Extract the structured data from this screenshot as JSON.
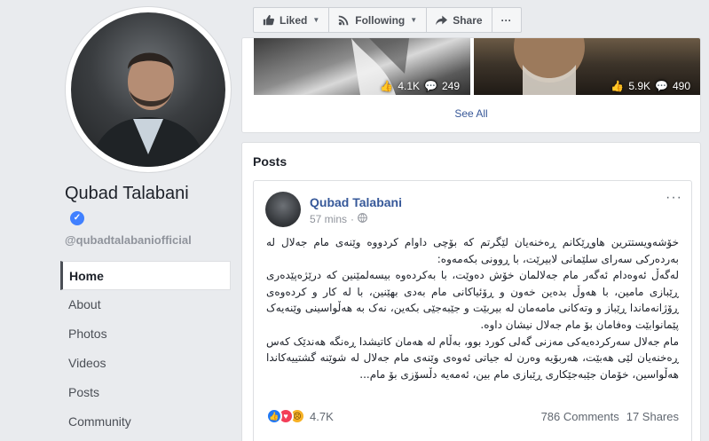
{
  "profile": {
    "name": "Qubad Talabani",
    "handle": "@qubadtalabaniofficial",
    "verified_symbol": "✓"
  },
  "nav": {
    "items": [
      {
        "label": "Home"
      },
      {
        "label": "About"
      },
      {
        "label": "Photos"
      },
      {
        "label": "Videos"
      },
      {
        "label": "Posts"
      },
      {
        "label": "Community"
      }
    ]
  },
  "actionbar": {
    "liked_label": "Liked",
    "following_label": "Following",
    "share_label": "Share",
    "more_label": "···"
  },
  "photos": {
    "items": [
      {
        "likes": "4.1K",
        "comments": "249"
      },
      {
        "likes": "5.9K",
        "comments": "490"
      }
    ],
    "see_all": "See All"
  },
  "posts": {
    "title": "Posts",
    "post": {
      "author": "Qubad Talabani",
      "time": "57 mins",
      "more": "···",
      "paragraphs": [
        "خۆشەویستترین هاوڕێکانم ڕەخنەیان لێگرتم کە بۆچی داوام کردووە وێنەی مام جەلال لە بەردەرکی سەرای سلێمانی لابیرێت، با ڕوونی بکەمەوە:",
        "لەگەڵ ئەوەدام ئەگەر مام جەلالمان خۆش دەوێت، با بەکردەوە بیسەلمێنین کە درێژەپێدەری ڕێبازی مامین، با هەوڵ بدەین خەون و ڕۆئیاکانی مام بەدی بهێنین، با لە کار و کردەوەی ڕۆژانەماندا ڕێباز و وتەکانی مامەمان لە بیربێت و جێبەجێی بکەین، نەک بە هەڵواسینی وێنەیەک پێمانوابێت وەفامان بۆ مام جەلال نیشان داوە.",
        "مام جەلال سەرکردەیەکی مەزنی گەلی کورد بوو، بەڵام لە هەمان کاتیشدا ڕەنگە هەندێک کەس ڕەخنەیان لێی هەبێت، هەربۆیە وەرن لە جیاتی ئەوەی وێنەی مام جەلال لە شوێنە گشتییەکاندا هەڵواسین، خۆمان جێبەجێکاری ڕێبازی مام بین، ئەمەیە دڵسۆزی بۆ مام..."
      ],
      "reactions_count": "4.7K",
      "comments": "786 Comments",
      "shares": "17 Shares"
    }
  },
  "colors": {
    "link": "#365899",
    "background": "#e9ebee",
    "like": "#2078f4",
    "love": "#f33e58",
    "sad": "#f7b125"
  }
}
